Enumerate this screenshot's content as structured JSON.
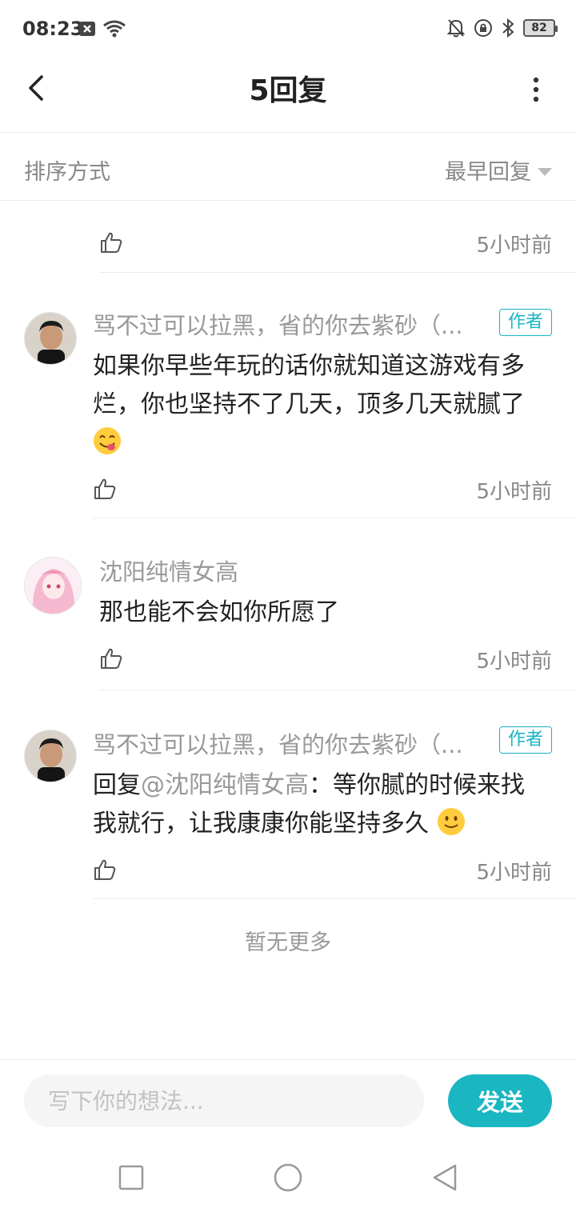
{
  "status_bar": {
    "time": "08:23",
    "battery": "82",
    "icons": [
      "close-box-icon",
      "wifi-icon",
      "mute-bell-icon",
      "rotation-lock-icon",
      "bluetooth-icon",
      "battery-icon"
    ]
  },
  "header": {
    "title": "5回复",
    "back_icon": "back-chevron-icon",
    "more_icon": "more-vertical-icon"
  },
  "sort_bar": {
    "label": "排序方式",
    "value": "最早回复"
  },
  "partial_item": {
    "time": "5小时前"
  },
  "replies": [
    {
      "username": "骂不过可以拉黑，省的你去紫砂（...",
      "badge": "作者",
      "content_line1": "如果你早些年玩的话你就知道这游戏有多",
      "content_line2": "烂，你也坚持不了几天，顶多几天就腻了",
      "emoji": "yum-emoji",
      "time": "5小时前"
    },
    {
      "username": "沈阳纯情女高",
      "content": "那也能不会如你所愿了",
      "time": "5小时前"
    },
    {
      "username": "骂不过可以拉黑，省的你去紫砂（...",
      "badge": "作者",
      "reply_prefix": "回复",
      "mention": "@沈阳纯情女高",
      "content_line1_rest": "：等你腻的时候来找",
      "content_line2": "我就行，让我康康你能坚持多久",
      "emoji": "smile-emoji",
      "time": "5小时前"
    }
  ],
  "no_more": "暂无更多",
  "input": {
    "placeholder": "写下你的想法...",
    "send_label": "发送"
  },
  "colors": {
    "accent": "#1ab6c2",
    "text_secondary": "#999999"
  }
}
